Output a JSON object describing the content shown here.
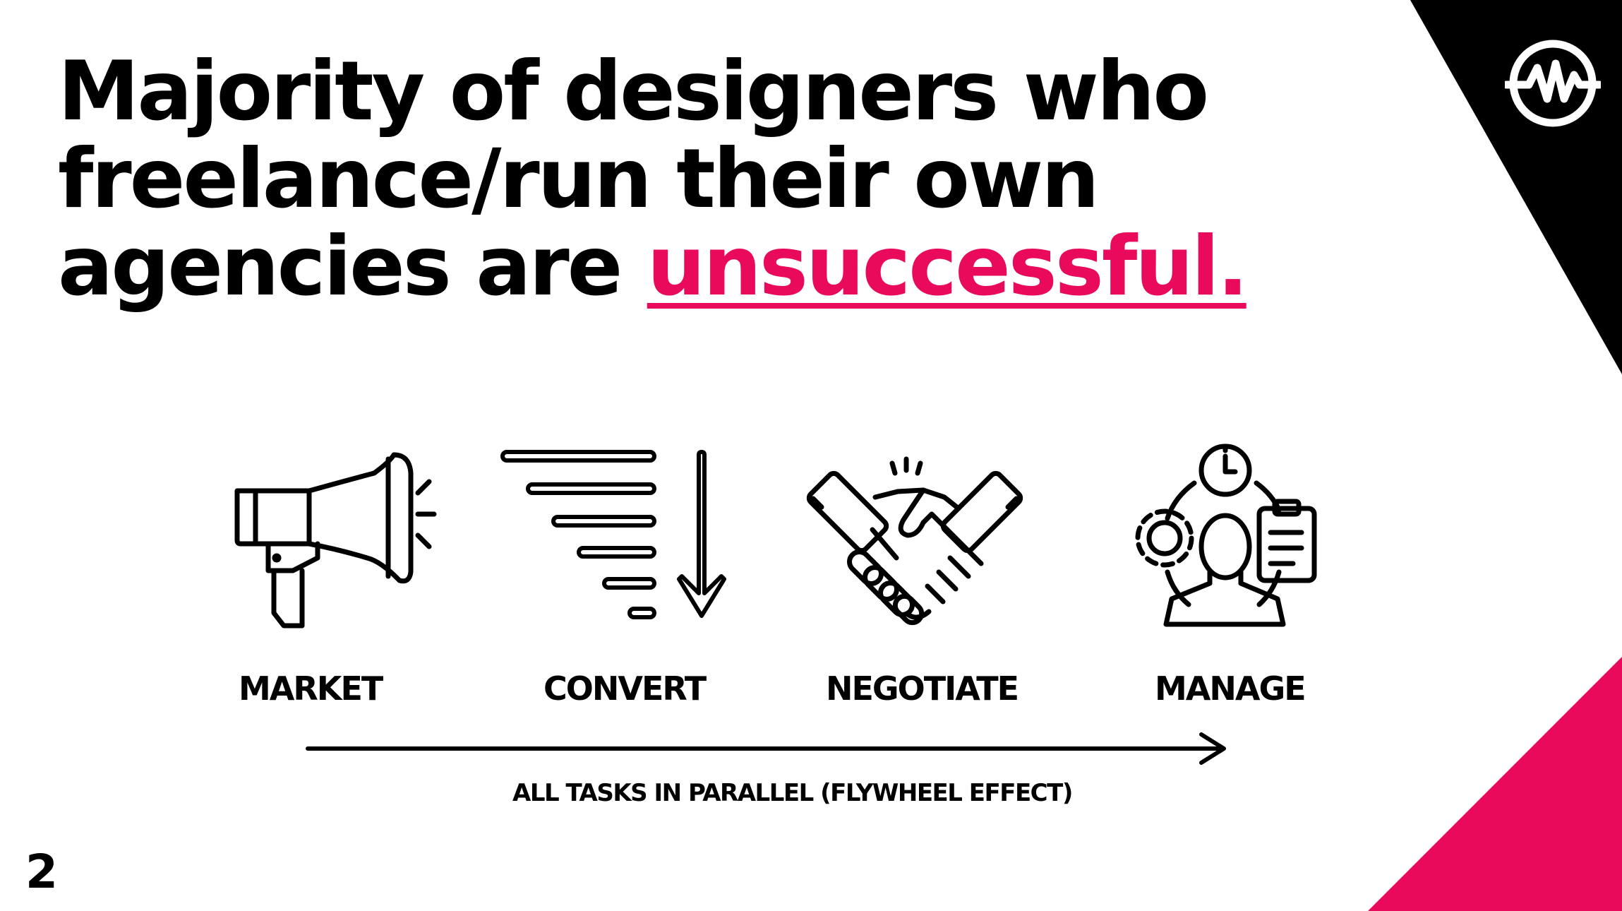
{
  "slide": {
    "headline": {
      "line1": "Majority of designers who",
      "line2": "freelance/run their own",
      "line3_prefix": "agencies are ",
      "highlight": "unsuccessful."
    },
    "steps": [
      {
        "label": "MARKET",
        "icon": "megaphone-icon"
      },
      {
        "label": "CONVERT",
        "icon": "funnel-arrow-icon"
      },
      {
        "label": "NEGOTIATE",
        "icon": "handshake-icon"
      },
      {
        "label": "MANAGE",
        "icon": "manager-icon"
      }
    ],
    "flow_caption": "ALL TASKS IN PARALLEL (FLYWHEEL EFFECT)",
    "page_number": "2"
  },
  "colors": {
    "accent": "#ea0a5c",
    "text": "#000000",
    "background": "#ffffff"
  }
}
